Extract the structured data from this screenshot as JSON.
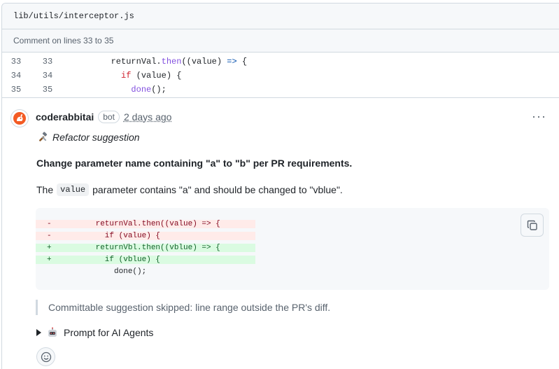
{
  "file": {
    "path": "lib/utils/interceptor.js"
  },
  "range": {
    "label": "Comment on lines 33 to 35"
  },
  "code_lines": [
    {
      "old": "33",
      "new": "33"
    },
    {
      "old": "34",
      "new": "34"
    },
    {
      "old": "35",
      "new": "35"
    }
  ],
  "code_text": {
    "l1_indent": "        ",
    "l1_a": "returnVal.",
    "l1_fn": "then",
    "l1_b": "((value) ",
    "l1_op": "=>",
    "l1_c": " {",
    "l2_indent": "          ",
    "l2_kw": "if",
    "l2_b": " (value) {",
    "l3_indent": "            ",
    "l3_fn": "done",
    "l3_b": "();"
  },
  "comment": {
    "author": "coderabbitai",
    "badge": "bot",
    "time": "2 days ago",
    "menu": "···",
    "refactor_label": "Refactor suggestion",
    "heading": "Change parameter name containing \"a\" to \"b\" per PR requirements.",
    "para_prefix": "The",
    "para_code": "value",
    "para_suffix": "parameter contains \"a\" and should be changed to \"vblue\".",
    "suggestion": [
      {
        "sign": "-",
        "text": "      returnVal.then((value) => {",
        "kind": "del"
      },
      {
        "sign": "-",
        "text": "        if (value) {",
        "kind": "del"
      },
      {
        "sign": "+",
        "text": "      returnVbl.then((vblue) => {",
        "kind": "add"
      },
      {
        "sign": "+",
        "text": "        if (vblue) {",
        "kind": "add"
      },
      {
        "sign": " ",
        "text": "          done();",
        "kind": "ctx"
      }
    ],
    "skipped_note": "Committable suggestion skipped: line range outside the PR's diff.",
    "details_label": "Prompt for AI Agents"
  },
  "colors": {
    "del_bg": "#ffebe9",
    "add_bg": "#dafbe1",
    "brand": "#f35b24"
  }
}
